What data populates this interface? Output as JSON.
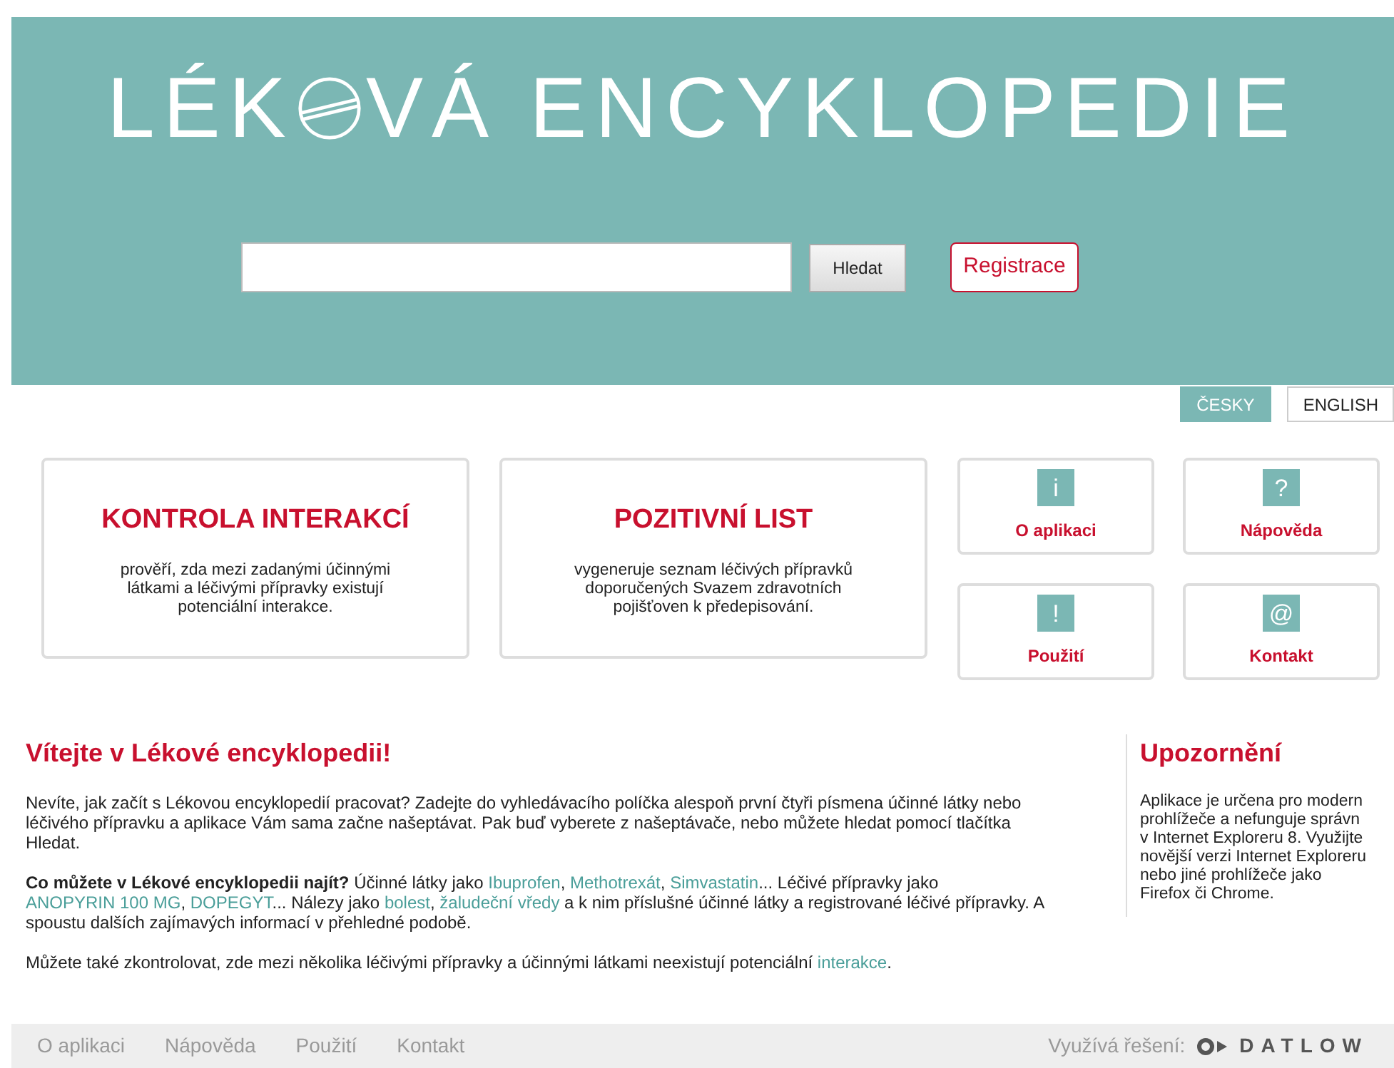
{
  "header": {
    "title_before": "LÉK",
    "title_after": "VÁ ENCYKLOPEDIE",
    "search_button": "Hledat",
    "register_button": "Registrace"
  },
  "languages": [
    {
      "label": "ČESKY",
      "selected": true
    },
    {
      "label": "ENGLISH",
      "selected": false
    }
  ],
  "feature_cards": [
    {
      "title": "KONTROLA INTERAKCÍ",
      "description": "prověří, zda mezi zadanými účinnými látkami a léčivými přípravky existují potenciální interakce."
    },
    {
      "title": "POZITIVNÍ LIST",
      "description": "vygeneruje seznam léčivých přípravků doporučených Svazem zdravotních pojišťoven k předepisování."
    }
  ],
  "tiles": [
    {
      "symbol": "i",
      "label": "O aplikaci"
    },
    {
      "symbol": "?",
      "label": "Nápověda"
    },
    {
      "symbol": "!",
      "label": "Použití"
    },
    {
      "symbol": "@",
      "label": "Kontakt"
    }
  ],
  "welcome": {
    "heading": "Vítejte v Lékové encyklopedii!",
    "paragraphs": [
      [
        {
          "kind": "text",
          "text": "Nevíte, jak začít s Lékovou encyklopedií pracovat? Zadejte do vyhledávacího políčka alespoň první čtyři písmena účinné látky nebo léčivého přípravku a aplikace Vám sama začne našeptávat. Pak buď vyberete z našeptávače, nebo můžete hledat pomocí tlačítka Hledat."
        }
      ],
      [
        {
          "kind": "bold",
          "text": "Co můžete v Lékové encyklopedii najít?"
        },
        {
          "kind": "text",
          "text": " Účinné látky jako "
        },
        {
          "kind": "link",
          "text": "Ibuprofen"
        },
        {
          "kind": "text",
          "text": ", "
        },
        {
          "kind": "link",
          "text": "Methotrexát"
        },
        {
          "kind": "text",
          "text": ", "
        },
        {
          "kind": "link",
          "text": "Simvastatin"
        },
        {
          "kind": "text",
          "text": "... Léčivé přípravky jako "
        },
        {
          "kind": "link",
          "text": "ANOPYRIN 100 MG"
        },
        {
          "kind": "text",
          "text": ", "
        },
        {
          "kind": "link",
          "text": "DOPEGYT"
        },
        {
          "kind": "text",
          "text": "... Nálezy jako "
        },
        {
          "kind": "link",
          "text": "bolest"
        },
        {
          "kind": "text",
          "text": ", "
        },
        {
          "kind": "link",
          "text": "žaludeční vředy"
        },
        {
          "kind": "text",
          "text": " a k nim příslušné účinné látky a registrované léčivé přípravky. A spoustu dalších zajímavých informací v přehledné podobě."
        }
      ],
      [
        {
          "kind": "text",
          "text": "Můžete také zkontrolovat, zde mezi několika léčivými přípravky a účinnými látkami neexistují potenciální "
        },
        {
          "kind": "link",
          "text": "interakce"
        },
        {
          "kind": "text",
          "text": "."
        }
      ]
    ]
  },
  "notice": {
    "heading": "Upozornění",
    "lines": [
      "Aplikace je určena pro modern",
      "prohlížeče a nefunguje správn",
      "v Internet Exploreru 8. Využijte",
      "novější verzi Internet Exploreru",
      "nebo jiné prohlížeče jako",
      "Firefox či Chrome."
    ]
  },
  "footer": {
    "links": [
      "O aplikaci",
      "Nápověda",
      "Použití",
      "Kontakt"
    ],
    "powered_by": "Využívá řešení:",
    "logo_text": "DATLOW"
  }
}
